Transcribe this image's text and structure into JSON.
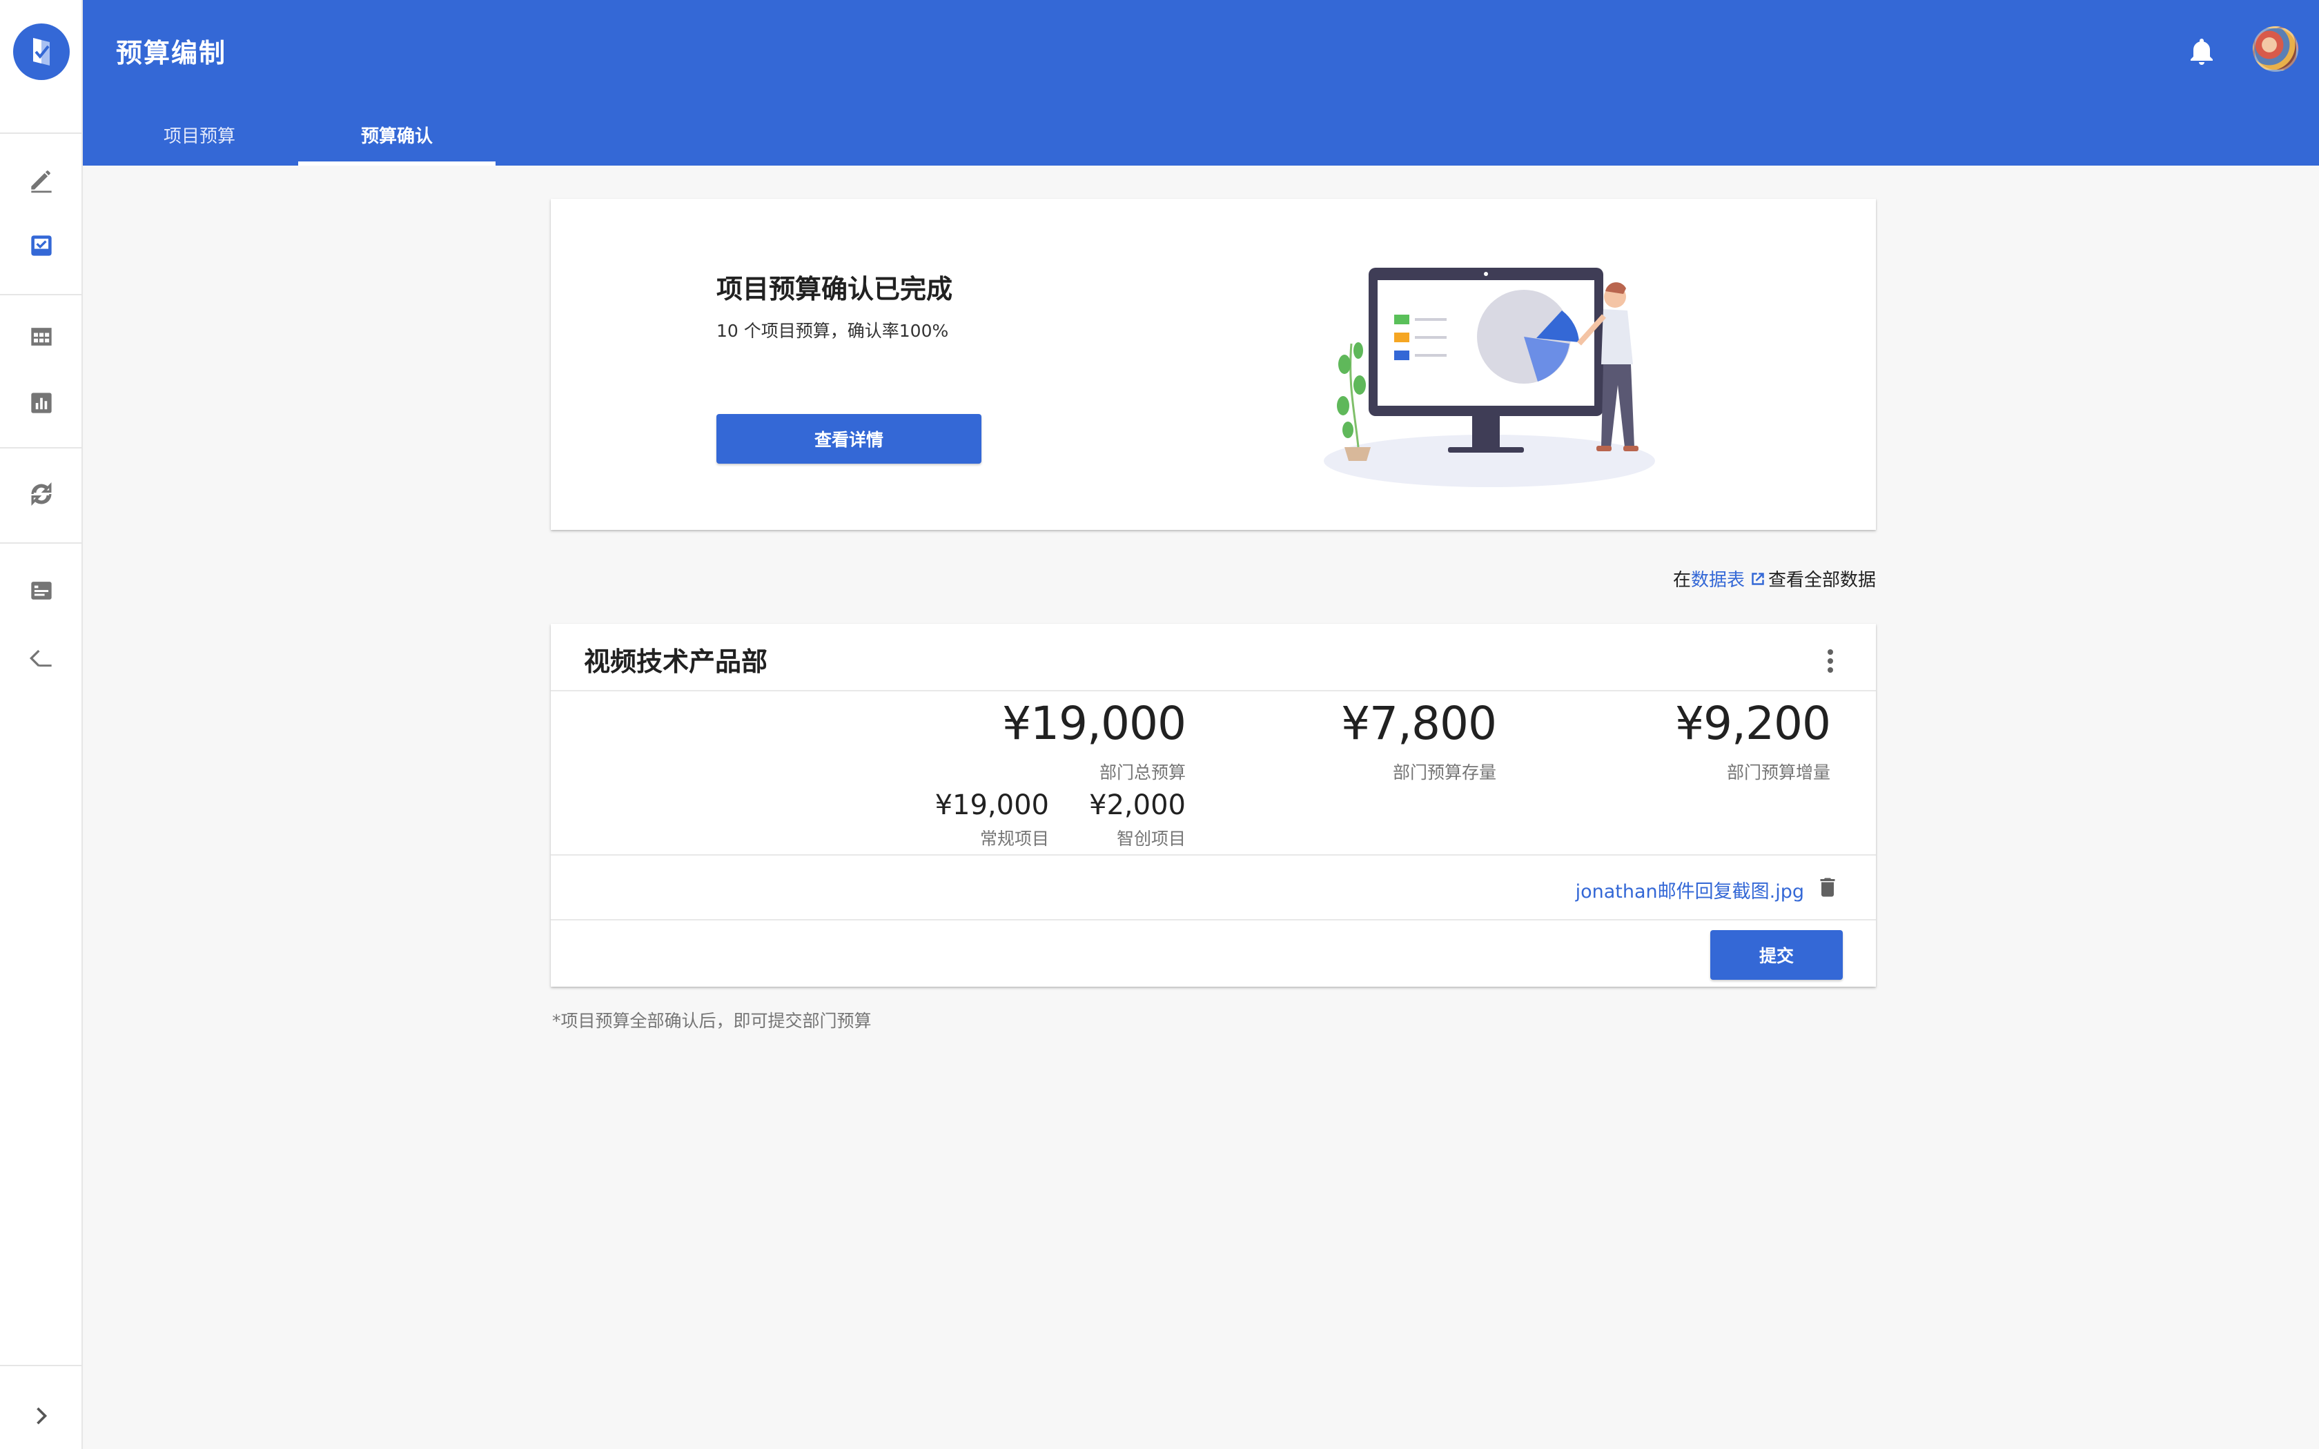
{
  "header": {
    "title": "预算编制",
    "tabs": [
      {
        "label": "项目预算",
        "active": false
      },
      {
        "label": "预算确认",
        "active": true
      }
    ]
  },
  "colors": {
    "primary": "#3468d6",
    "background": "#f7f7f7"
  },
  "sidebar": {
    "icons": [
      "edit-icon",
      "checkbox-inbox-icon",
      "table-grid-icon",
      "bar-chart-icon",
      "sync-icon",
      "list-card-icon",
      "collapse-left-icon",
      "expand-right-icon"
    ]
  },
  "hero": {
    "title": "项目预算确认已完成",
    "subtitle": "10 个项目预算，确认率100%",
    "button": "查看详情"
  },
  "sheet_link": {
    "prefix": "在",
    "link": "数据表",
    "suffix": "查看全部数据"
  },
  "department": {
    "name": "视频技术产品部",
    "total": {
      "value": "¥19,000",
      "label": "部门总预算"
    },
    "stock": {
      "value": "¥7,800",
      "label": "部门预算存量"
    },
    "increment": {
      "value": "¥9,200",
      "label": "部门预算增量"
    },
    "regular": {
      "value": "¥19,000",
      "label": "常规项目"
    },
    "innovation": {
      "value": "¥2,000",
      "label": "智创项目"
    },
    "attachment": "jonathan邮件回复截图.jpg",
    "submit": "提交"
  },
  "footnote": "*项目预算全部确认后，即可提交部门预算"
}
